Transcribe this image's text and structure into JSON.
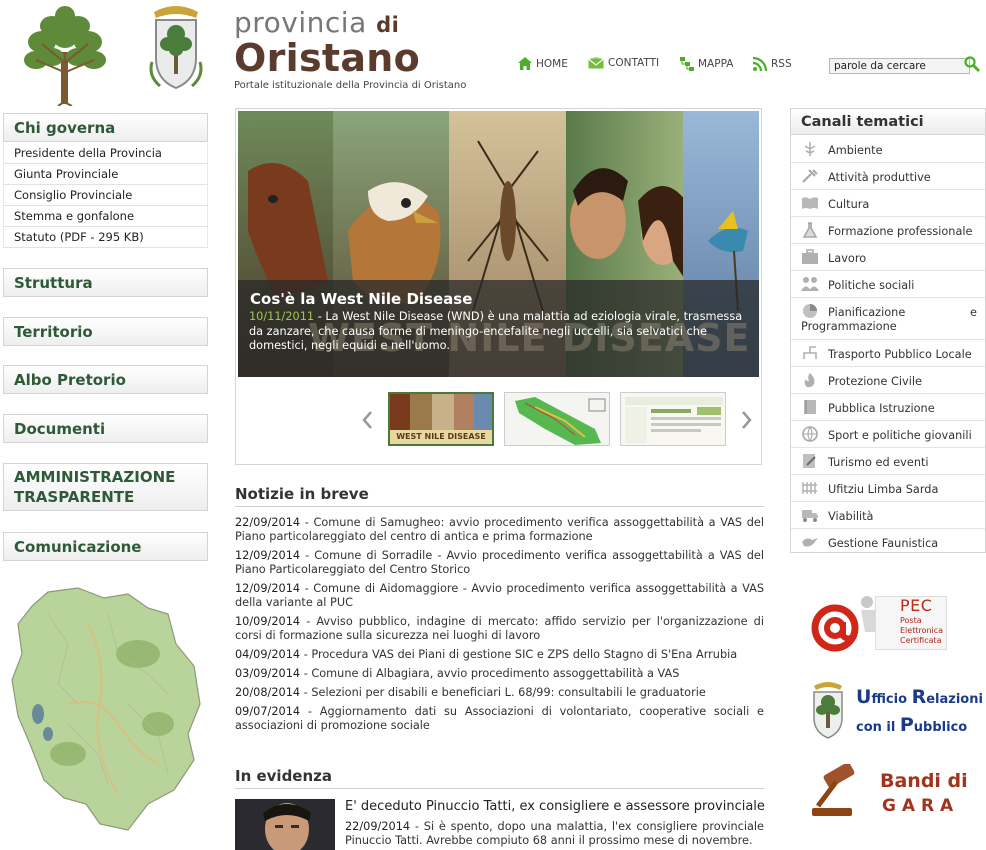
{
  "header": {
    "brand_line1": "provincia",
    "brand_di": "di",
    "brand_line2": "Oristano",
    "subtitle": "Portale istituzionale della Provincia di Oristano",
    "nav": [
      {
        "label": "HOME",
        "icon": "home-icon"
      },
      {
        "label": "CONTATTI",
        "icon": "mail-icon"
      },
      {
        "label": "MAPPA",
        "icon": "sitemap-icon"
      },
      {
        "label": "RSS",
        "icon": "rss-icon"
      }
    ],
    "search_value": "parole da cercare"
  },
  "left_nav": {
    "chi_governa": "Chi governa",
    "chi_governa_items": [
      "Presidente della Provincia",
      "Giunta Provinciale",
      "Consiglio Provinciale",
      "Stemma e gonfalone",
      "Statuto (PDF - 295 KB)"
    ],
    "sections": [
      "Struttura",
      "Territorio",
      "Albo Pretorio",
      "Documenti"
    ],
    "amministrazione_line1": "AMMINISTRAZIONE",
    "amministrazione_line2": "TRASPARENTE",
    "comunicazione": "Comunicazione"
  },
  "slider": {
    "title": "Cos'è la West Nile Disease",
    "date": "10/11/2011",
    "body": " - La West Nile Disease (WND) è una malattia ad eziologia virale, trasmessa da zanzare, che causa forme di meningo-encefalite negli uccelli, sia selvatici che domestici, negli equidi e nell'uomo.",
    "watermark": "West Nile Disease",
    "thumb1_label": "WEST NILE DISEASE"
  },
  "notizie": {
    "title": "Notizie in breve",
    "items": [
      {
        "date": "22/09/2014",
        "text": " - Comune di Samugheo: avvio procedimento verifica assoggettabilità a VAS del Piano particolareggiato del centro di antica e prima formazione"
      },
      {
        "date": "12/09/2014",
        "text": " - Comune di Sorradile - Avvio procedimento verifica assoggettabilità a VAS del Piano Particolareggiato del Centro Storico"
      },
      {
        "date": "12/09/2014",
        "text": " - Comune di Aidomaggiore - Avvio procedimento verifica assoggettabilità a VAS della variante al PUC"
      },
      {
        "date": "10/09/2014",
        "text": " - Avviso pubblico, indagine di mercato: affido servizio per l'organizzazione di corsi di formazione sulla sicurezza nei luoghi di lavoro"
      },
      {
        "date": "04/09/2014",
        "text": " - Procedura VAS dei Piani di gestione SIC e ZPS dello Stagno di S'Ena Arrubia"
      },
      {
        "date": "03/09/2014",
        "text": " - Comune di Albagiara, avvio procedimento assoggettabilità a VAS"
      },
      {
        "date": "20/08/2014",
        "text": " - Selezioni per disabili e beneficiari L. 68/99: consultabili le graduatorie"
      },
      {
        "date": "09/07/2014",
        "text": " - Aggiornamento dati su Associazioni di volontariato, cooperative sociali e associazioni di promozione sociale"
      }
    ]
  },
  "evidenza": {
    "title": "In evidenza",
    "headline": "E' deceduto Pinuccio Tatti, ex consigliere e assessore provinciale",
    "date": "22/09/2014",
    "text": " - Si è spento, dopo una malattia, l'ex consigliere provinciale Pinuccio Tatti. Avrebbe compiuto 68 anni il prossimo mese di novembre."
  },
  "canali": {
    "title": "Canali tematici",
    "items": [
      {
        "label": "Ambiente",
        "icon": "leaf-icon"
      },
      {
        "label": "Attività produttive",
        "icon": "tools-icon"
      },
      {
        "label": "Cultura",
        "icon": "book-icon"
      },
      {
        "label": "Formazione professionale",
        "icon": "flask-icon"
      },
      {
        "label": "Lavoro",
        "icon": "briefcase-icon"
      },
      {
        "label": "Politiche sociali",
        "icon": "people-icon"
      },
      {
        "label": "Pianificazione e Programmazione",
        "icon": "pie-chart-icon"
      },
      {
        "label": "Trasporto Pubblico Locale",
        "icon": "route-icon"
      },
      {
        "label": "Protezione Civile",
        "icon": "fire-icon"
      },
      {
        "label": "Pubblica Istruzione",
        "icon": "notebook-icon"
      },
      {
        "label": "Sport e politiche giovanili",
        "icon": "ball-icon"
      },
      {
        "label": "Turismo ed eventi",
        "icon": "pencil-icon"
      },
      {
        "label": "Ufitziu Limba Sarda",
        "icon": "grid-icon"
      },
      {
        "label": "Viabilità",
        "icon": "truck-icon"
      },
      {
        "label": "Gestione Faunistica",
        "icon": "bird-icon"
      }
    ]
  },
  "banners": {
    "pec_title": "PEC",
    "pec_sub1": "Posta",
    "pec_sub2": "Elettronica",
    "pec_sub3": "Certificata",
    "urp_line1_big": "U",
    "urp_line1_rest": "fficio ",
    "urp_line1_big2": "R",
    "urp_line1_rest2": "elazioni",
    "urp_line2_pre": "con il ",
    "urp_line2_big": "P",
    "urp_line2_rest": "ubblico",
    "bandi_line1": "Bandi di",
    "bandi_line2": "G A R A"
  },
  "colors": {
    "brand_brown": "#5a3b2e",
    "nav_green": "#2e5a38",
    "date_green": "#9ec84c",
    "search_green": "#4caf2a"
  }
}
